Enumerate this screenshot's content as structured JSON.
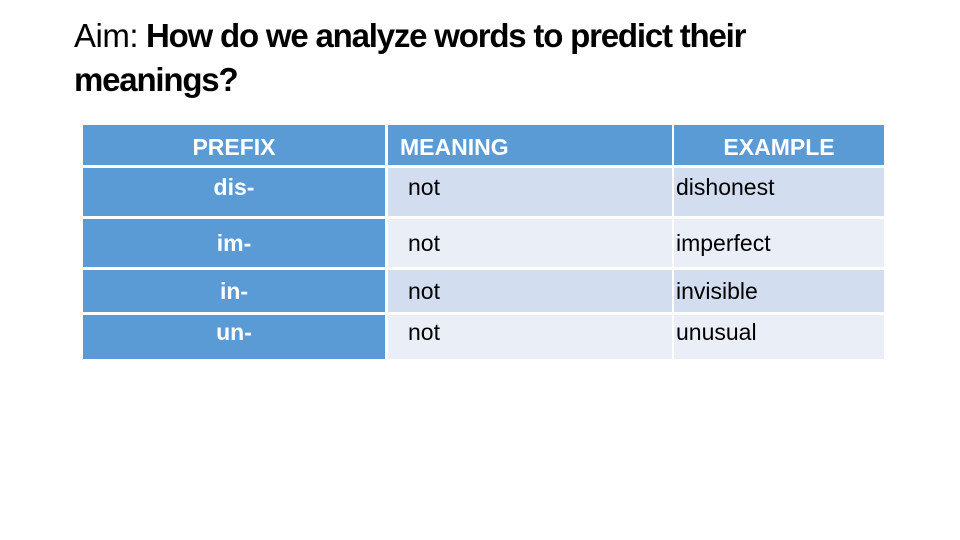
{
  "slide": {
    "title_label": "Aim:",
    "title_question": "How do we analyze words to predict their meanings?"
  },
  "table": {
    "headers": [
      "PREFIX",
      "MEANING",
      "EXAMPLE"
    ],
    "rows": [
      {
        "prefix": "dis-",
        "meaning": "not",
        "example": "dishonest"
      },
      {
        "prefix": "im-",
        "meaning": "not",
        "example": "imperfect"
      },
      {
        "prefix": "in-",
        "meaning": "not",
        "example": "invisible"
      },
      {
        "prefix": "un-",
        "meaning": "not",
        "example": "unusual"
      }
    ]
  },
  "colors": {
    "header_and_first_column": "#5b9bd5",
    "row_band_dark": "#d2deef",
    "row_band_light": "#eaeff7"
  }
}
